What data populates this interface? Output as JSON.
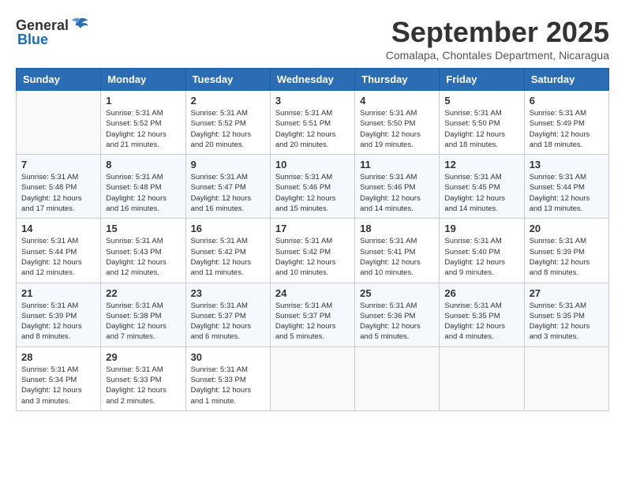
{
  "logo": {
    "text_general": "General",
    "text_blue": "Blue"
  },
  "title": "September 2025",
  "subtitle": "Comalapa, Chontales Department, Nicaragua",
  "weekdays": [
    "Sunday",
    "Monday",
    "Tuesday",
    "Wednesday",
    "Thursday",
    "Friday",
    "Saturday"
  ],
  "weeks": [
    [
      {
        "day": "",
        "detail": ""
      },
      {
        "day": "1",
        "detail": "Sunrise: 5:31 AM\nSunset: 5:52 PM\nDaylight: 12 hours\nand 21 minutes."
      },
      {
        "day": "2",
        "detail": "Sunrise: 5:31 AM\nSunset: 5:52 PM\nDaylight: 12 hours\nand 20 minutes."
      },
      {
        "day": "3",
        "detail": "Sunrise: 5:31 AM\nSunset: 5:51 PM\nDaylight: 12 hours\nand 20 minutes."
      },
      {
        "day": "4",
        "detail": "Sunrise: 5:31 AM\nSunset: 5:50 PM\nDaylight: 12 hours\nand 19 minutes."
      },
      {
        "day": "5",
        "detail": "Sunrise: 5:31 AM\nSunset: 5:50 PM\nDaylight: 12 hours\nand 18 minutes."
      },
      {
        "day": "6",
        "detail": "Sunrise: 5:31 AM\nSunset: 5:49 PM\nDaylight: 12 hours\nand 18 minutes."
      }
    ],
    [
      {
        "day": "7",
        "detail": "Sunrise: 5:31 AM\nSunset: 5:48 PM\nDaylight: 12 hours\nand 17 minutes."
      },
      {
        "day": "8",
        "detail": "Sunrise: 5:31 AM\nSunset: 5:48 PM\nDaylight: 12 hours\nand 16 minutes."
      },
      {
        "day": "9",
        "detail": "Sunrise: 5:31 AM\nSunset: 5:47 PM\nDaylight: 12 hours\nand 16 minutes."
      },
      {
        "day": "10",
        "detail": "Sunrise: 5:31 AM\nSunset: 5:46 PM\nDaylight: 12 hours\nand 15 minutes."
      },
      {
        "day": "11",
        "detail": "Sunrise: 5:31 AM\nSunset: 5:46 PM\nDaylight: 12 hours\nand 14 minutes."
      },
      {
        "day": "12",
        "detail": "Sunrise: 5:31 AM\nSunset: 5:45 PM\nDaylight: 12 hours\nand 14 minutes."
      },
      {
        "day": "13",
        "detail": "Sunrise: 5:31 AM\nSunset: 5:44 PM\nDaylight: 12 hours\nand 13 minutes."
      }
    ],
    [
      {
        "day": "14",
        "detail": "Sunrise: 5:31 AM\nSunset: 5:44 PM\nDaylight: 12 hours\nand 12 minutes."
      },
      {
        "day": "15",
        "detail": "Sunrise: 5:31 AM\nSunset: 5:43 PM\nDaylight: 12 hours\nand 12 minutes."
      },
      {
        "day": "16",
        "detail": "Sunrise: 5:31 AM\nSunset: 5:42 PM\nDaylight: 12 hours\nand 11 minutes."
      },
      {
        "day": "17",
        "detail": "Sunrise: 5:31 AM\nSunset: 5:42 PM\nDaylight: 12 hours\nand 10 minutes."
      },
      {
        "day": "18",
        "detail": "Sunrise: 5:31 AM\nSunset: 5:41 PM\nDaylight: 12 hours\nand 10 minutes."
      },
      {
        "day": "19",
        "detail": "Sunrise: 5:31 AM\nSunset: 5:40 PM\nDaylight: 12 hours\nand 9 minutes."
      },
      {
        "day": "20",
        "detail": "Sunrise: 5:31 AM\nSunset: 5:39 PM\nDaylight: 12 hours\nand 8 minutes."
      }
    ],
    [
      {
        "day": "21",
        "detail": "Sunrise: 5:31 AM\nSunset: 5:39 PM\nDaylight: 12 hours\nand 8 minutes."
      },
      {
        "day": "22",
        "detail": "Sunrise: 5:31 AM\nSunset: 5:38 PM\nDaylight: 12 hours\nand 7 minutes."
      },
      {
        "day": "23",
        "detail": "Sunrise: 5:31 AM\nSunset: 5:37 PM\nDaylight: 12 hours\nand 6 minutes."
      },
      {
        "day": "24",
        "detail": "Sunrise: 5:31 AM\nSunset: 5:37 PM\nDaylight: 12 hours\nand 5 minutes."
      },
      {
        "day": "25",
        "detail": "Sunrise: 5:31 AM\nSunset: 5:36 PM\nDaylight: 12 hours\nand 5 minutes."
      },
      {
        "day": "26",
        "detail": "Sunrise: 5:31 AM\nSunset: 5:35 PM\nDaylight: 12 hours\nand 4 minutes."
      },
      {
        "day": "27",
        "detail": "Sunrise: 5:31 AM\nSunset: 5:35 PM\nDaylight: 12 hours\nand 3 minutes."
      }
    ],
    [
      {
        "day": "28",
        "detail": "Sunrise: 5:31 AM\nSunset: 5:34 PM\nDaylight: 12 hours\nand 3 minutes."
      },
      {
        "day": "29",
        "detail": "Sunrise: 5:31 AM\nSunset: 5:33 PM\nDaylight: 12 hours\nand 2 minutes."
      },
      {
        "day": "30",
        "detail": "Sunrise: 5:31 AM\nSunset: 5:33 PM\nDaylight: 12 hours\nand 1 minute."
      },
      {
        "day": "",
        "detail": ""
      },
      {
        "day": "",
        "detail": ""
      },
      {
        "day": "",
        "detail": ""
      },
      {
        "day": "",
        "detail": ""
      }
    ]
  ]
}
